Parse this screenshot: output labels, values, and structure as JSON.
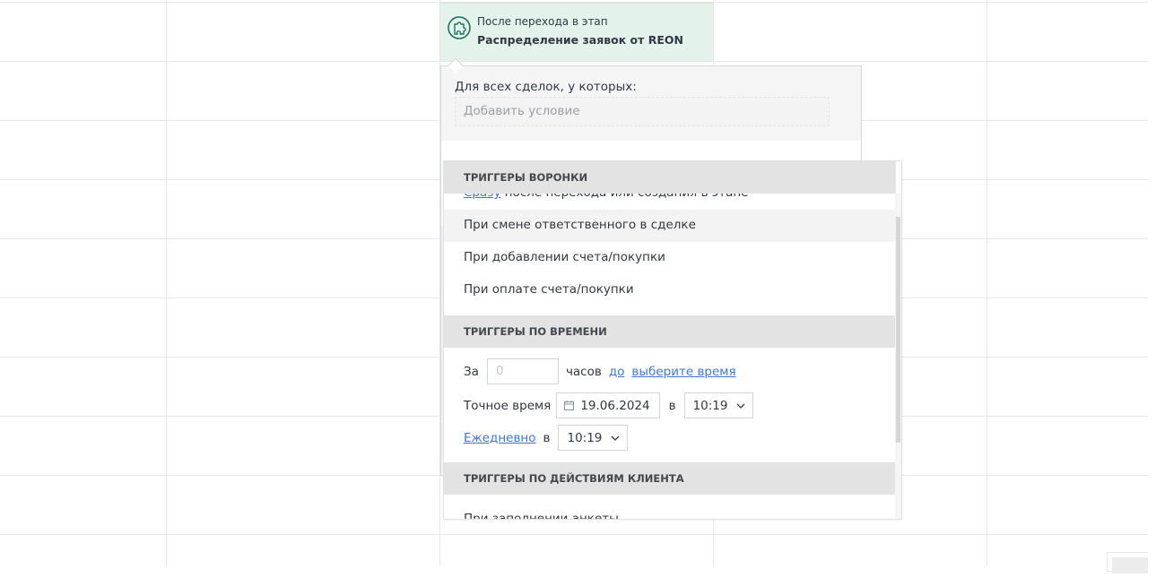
{
  "stage": {
    "subtitle": "После перехода в этап",
    "title": "Распределение заявок от REON",
    "icon": "puzzle-icon"
  },
  "conditions": {
    "label": "Для всех сделок, у которых:",
    "add_placeholder": "Добавить условие"
  },
  "dropdown": {
    "funnel_header": "Триггеры воронки",
    "funnel_partial": {
      "link": "Сразу",
      "rest": " после перехода или создания в этапе"
    },
    "funnel_items": [
      "При смене ответственного в сделке",
      "При добавлении счета/покупки",
      "При оплате счета/покупки"
    ],
    "time_header": "Триггеры по времени",
    "time_rows": {
      "za_label": "За",
      "hours_value": "0",
      "hours_label": "часов",
      "do_link": "до",
      "choose_time_link": "выберите время",
      "exact_label": "Точное время",
      "date_value": "19.06.2024",
      "v_label": "в",
      "exact_time": "10:19",
      "daily_link": "Ежедневно",
      "daily_v_label": "в",
      "daily_time": "10:19"
    },
    "client_header": "Триггеры по действиям клиента",
    "client_partial": "При заполнении анкеты"
  },
  "colors": {
    "accent_bg": "#e3f3ec",
    "accent_icon": "#1e6f5c",
    "link": "#4077d1",
    "header_bg": "#e3e3e3"
  }
}
